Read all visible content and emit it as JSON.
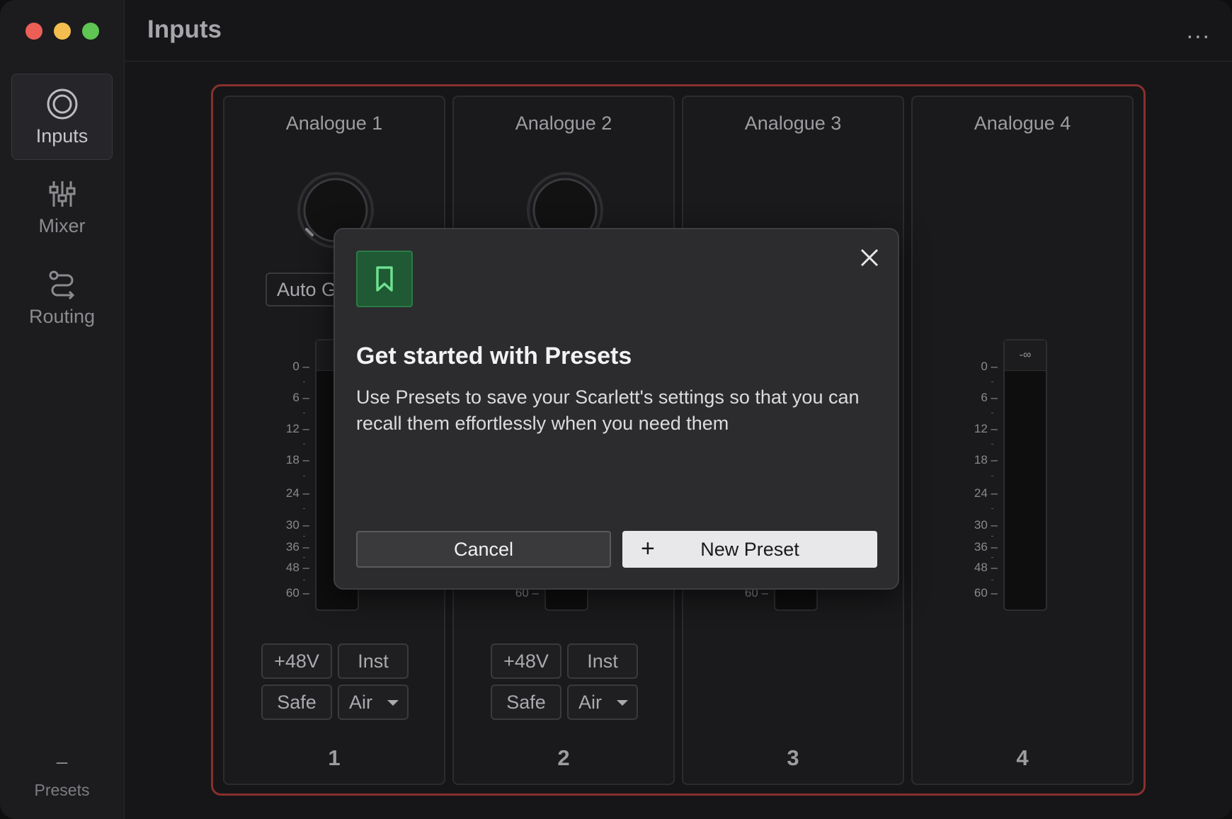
{
  "header": {
    "title": "Inputs",
    "more": "..."
  },
  "sidebar": {
    "items": [
      {
        "label": "Inputs",
        "icon": "inputs-icon"
      },
      {
        "label": "Mixer",
        "icon": "mixer-icon"
      },
      {
        "label": "Routing",
        "icon": "routing-icon"
      }
    ],
    "presets_value": "–",
    "presets_label": "Presets"
  },
  "channels": [
    {
      "title": "Analogue 1",
      "number": "1",
      "auto_gain": "Auto Gain",
      "phantom": "+48V",
      "inst": "Inst",
      "safe": "Safe",
      "air": "Air",
      "meter_cap": "–"
    },
    {
      "title": "Analogue 2",
      "number": "2",
      "phantom": "+48V",
      "inst": "Inst",
      "safe": "Safe",
      "air": "Air"
    },
    {
      "title": "Analogue 3",
      "number": "3"
    },
    {
      "title": "Analogue 4",
      "number": "4",
      "meter_cap": "-∞"
    }
  ],
  "meter_scale": [
    "0",
    "6",
    "12",
    "18",
    "24",
    "30",
    "36",
    "48",
    "60"
  ],
  "dialog": {
    "title": "Get started with Presets",
    "body": "Use Presets to save your Scarlett's settings so that you can recall them effortlessly when you need them",
    "cancel": "Cancel",
    "new_preset": "New Preset",
    "plus": "+"
  },
  "colors": {
    "accent_red": "#8a2f2d",
    "preset_green": "#1f5a34"
  }
}
